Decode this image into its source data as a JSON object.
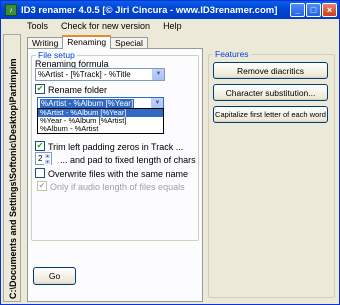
{
  "window": {
    "title": "ID3 renamer 4.0.5 [© Jiri Cincura - www.ID3renamer.com]",
    "minimize_glyph": "_",
    "maximize_glyph": "□",
    "close_glyph": "×"
  },
  "menu": {
    "items": [
      "Tools",
      "Check for new version",
      "Help"
    ]
  },
  "sidebar": {
    "path": "C:\\Documents and Settings\\Softonic\\Desktop\\Partimpim"
  },
  "tabs": [
    {
      "label": "Writing",
      "active": false
    },
    {
      "label": "Renaming",
      "active": true
    },
    {
      "label": "Special",
      "active": false
    }
  ],
  "file_setup": {
    "legend": "File setup",
    "renaming_formula_label": "Renaming formula",
    "renaming_formula_value": "%Artist - [%Track] - %Title",
    "rename_folder_label": "Rename folder",
    "rename_folder_checked": true,
    "folder_formula_value": "%Artist - %Album [%Year]",
    "folder_options": [
      "%Artist - %Album [%Year]",
      "%Year - %Album [%Artist]",
      "%Album - %Artist"
    ],
    "trim_label": "Trim left padding zeros in Track ...",
    "trim_checked": true,
    "pad_value": "2",
    "pad_label": "... and pad to fixed length of chars",
    "overwrite_label": "Overwrite files with the same name",
    "overwrite_checked": false,
    "audio_length_label": "Only if audio length of files equals",
    "audio_length_checked": true,
    "go_label": "Go"
  },
  "features": {
    "legend": "Features",
    "buttons": [
      "Remove diacritics",
      "Character substitution...",
      "Capitalize first letter of each word"
    ]
  }
}
